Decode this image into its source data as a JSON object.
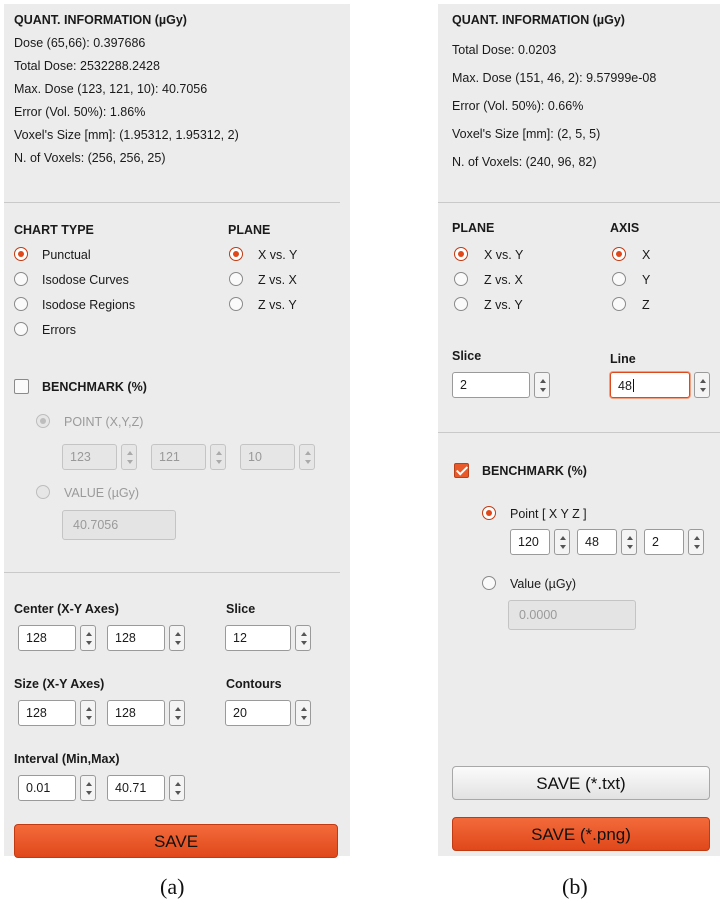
{
  "panel_a": {
    "info": {
      "title": "QUANT. INFORMATION (µGy)",
      "lines": [
        "Dose (65,66): 0.397686",
        "Total Dose: 2532288.2428",
        "Max. Dose (123, 121, 10): 40.7056",
        "Error (Vol. 50%): 1.86%",
        "Voxel's Size [mm]: (1.95312, 1.95312, 2)",
        "N. of Voxels: (256, 256, 25)"
      ]
    },
    "chart_type": {
      "title": "CHART TYPE",
      "options": [
        "Punctual",
        "Isodose Curves",
        "Isodose Regions",
        "Errors"
      ],
      "selected": "Punctual"
    },
    "plane": {
      "title": "PLANE",
      "options": [
        "X vs. Y",
        "Z vs. X",
        "Z vs. Y"
      ],
      "selected": "X vs. Y"
    },
    "benchmark": {
      "label": "BENCHMARK (%)",
      "checked": false,
      "point_label": "POINT (X,Y,Z)",
      "point_values": [
        "123",
        "121",
        "10"
      ],
      "value_label": "VALUE (µGy)",
      "value": "40.7056"
    },
    "center": {
      "label": "Center (X-Y Axes)",
      "values": [
        "128",
        "128"
      ]
    },
    "slice": {
      "label": "Slice",
      "value": "12"
    },
    "size": {
      "label": "Size (X-Y Axes)",
      "values": [
        "128",
        "128"
      ]
    },
    "contours": {
      "label": "Contours",
      "value": "20"
    },
    "interval": {
      "label": "Interval (Min,Max)",
      "values": [
        "0.01",
        "40.71"
      ]
    },
    "save_label": "SAVE"
  },
  "panel_b": {
    "info": {
      "title": "QUANT. INFORMATION (µGy)",
      "lines": [
        "Total Dose: 0.0203",
        "Max. Dose (151, 46, 2): 9.57999e-08",
        "Error (Vol. 50%): 0.66%",
        "Voxel's Size [mm]: (2, 5, 5)",
        "N. of Voxels: (240, 96, 82)"
      ]
    },
    "plane": {
      "title": "PLANE",
      "options": [
        "X vs. Y",
        "Z vs. X",
        "Z vs. Y"
      ],
      "selected": "X vs. Y"
    },
    "axis": {
      "title": "AXIS",
      "options": [
        "X",
        "Y",
        "Z"
      ],
      "selected": "X"
    },
    "slice": {
      "label": "Slice",
      "value": "2"
    },
    "line": {
      "label": "Line",
      "value": "48"
    },
    "benchmark": {
      "label": "BENCHMARK (%)",
      "checked": true,
      "point_label": "Point [ X Y Z ]",
      "point_values": [
        "120",
        "48",
        "2"
      ],
      "value_label": "Value (µGy)",
      "value": "0.0000"
    },
    "save_txt_label": "SAVE (*.txt)",
    "save_png_label": "SAVE (*.png)"
  },
  "captions": [
    "(a)",
    "(b)"
  ],
  "colors": {
    "accent": "#e0481b",
    "panel_bg": "#ececec"
  }
}
